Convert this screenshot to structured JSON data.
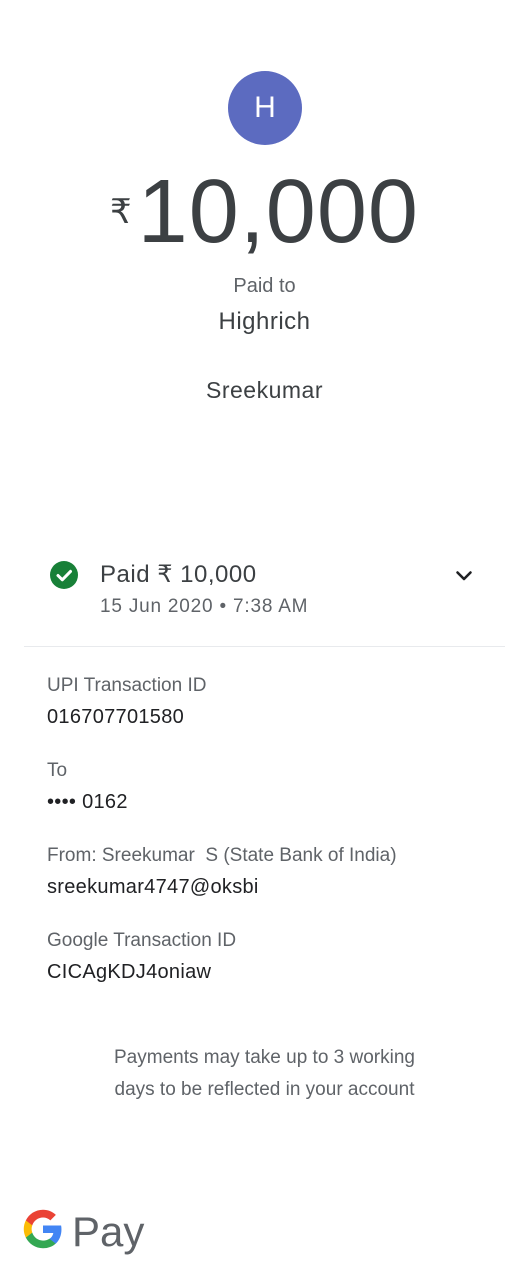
{
  "avatar": {
    "initial": "H",
    "color": "#5c6bc0"
  },
  "payment": {
    "currency_symbol": "₹",
    "amount": "10,000",
    "paid_to_label": "Paid to",
    "payee": "Highrich",
    "note": "Sreekumar"
  },
  "status": {
    "title": "Paid ₹ 10,000",
    "datetime": "15 Jun 2020 • 7:38 AM",
    "icon": "check-circle-icon",
    "color": "#188038"
  },
  "details": [
    {
      "label": "UPI Transaction ID",
      "value": "016707701580"
    },
    {
      "label": "To",
      "value": "•••• 0162"
    },
    {
      "label": "From: Sreekumar  S (State Bank of India)",
      "value": "sreekumar4747@oksbi"
    },
    {
      "label": "Google Transaction ID",
      "value": "CICAgKDJ4oniaw"
    }
  ],
  "disclaimer": {
    "line1": "Payments may take up to 3 working",
    "line2": "days to be reflected in your account"
  },
  "branding": {
    "logo_text": "Pay",
    "logo_icon": "google-g-icon"
  }
}
